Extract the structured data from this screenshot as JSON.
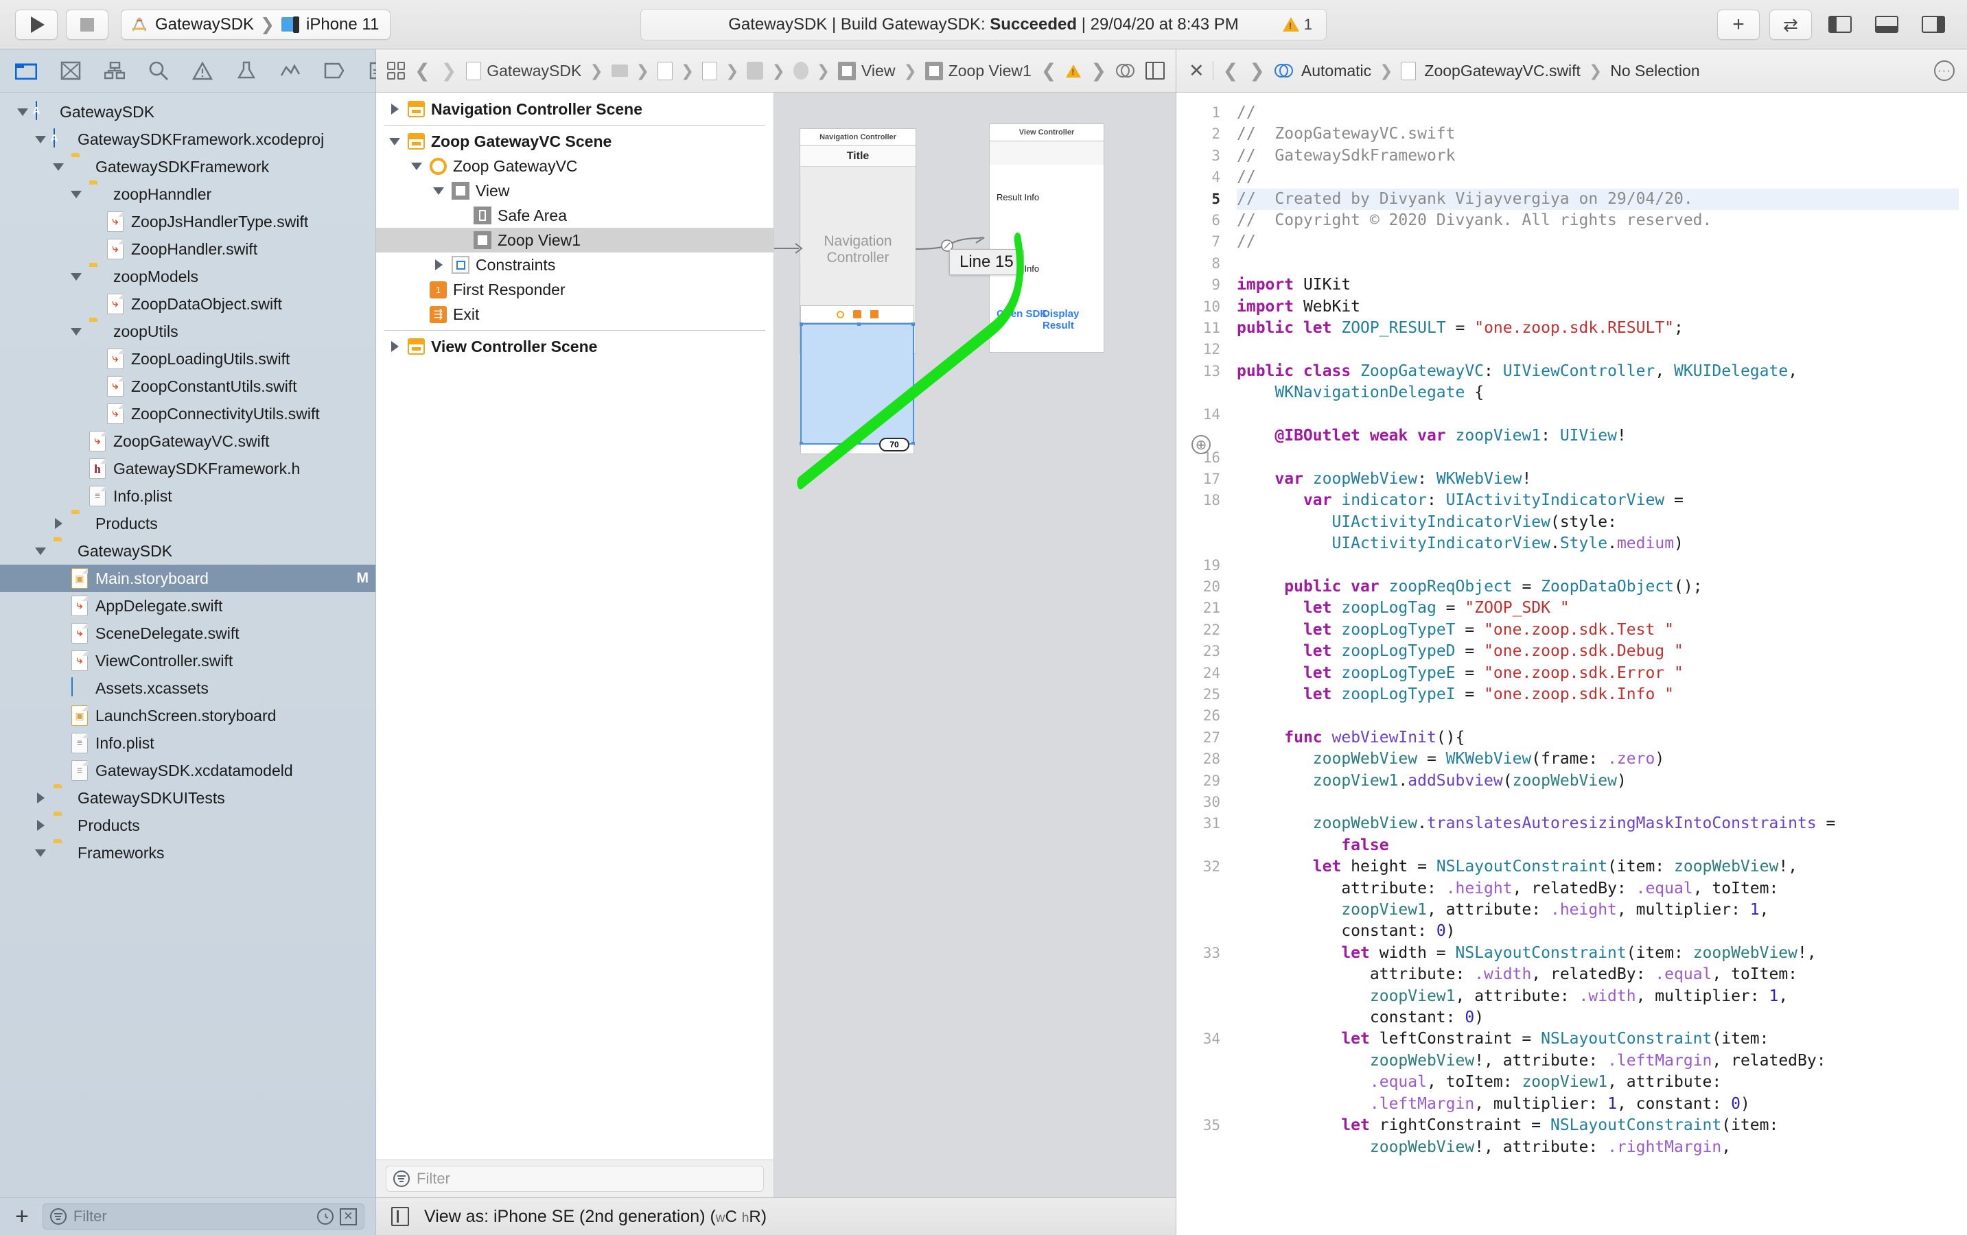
{
  "toolbar": {
    "run_label": "Run",
    "stop_label": "Stop",
    "scheme_name": "GatewaySDK",
    "destination_name": "iPhone 11",
    "status_prefix": "GatewaySDK | Build GatewaySDK: ",
    "status_result": "Succeeded",
    "status_suffix": " | 29/04/20 at 8:43 PM",
    "warning_count": "1",
    "add_label": "+",
    "toggle_label": "⇄"
  },
  "navigator": {
    "tabs": [
      {
        "name": "folder-icon",
        "active": true
      },
      {
        "name": "source-control-icon",
        "active": false
      },
      {
        "name": "symbol-icon",
        "active": false
      },
      {
        "name": "search-icon",
        "active": false
      },
      {
        "name": "warning-icon",
        "active": false
      },
      {
        "name": "test-icon",
        "active": false
      },
      {
        "name": "debug-icon",
        "active": false
      },
      {
        "name": "breakpoint-icon",
        "active": false
      },
      {
        "name": "report-icon",
        "active": false
      }
    ],
    "items": [
      {
        "label": "GatewaySDK",
        "indent": 0,
        "twist": "down",
        "icon": "project",
        "modified": ""
      },
      {
        "label": "GatewaySDKFramework.xcodeproj",
        "indent": 1,
        "twist": "down",
        "icon": "project",
        "modified": ""
      },
      {
        "label": "GatewaySDKFramework",
        "indent": 2,
        "twist": "down",
        "icon": "folder",
        "modified": ""
      },
      {
        "label": "zoopHanndler",
        "indent": 3,
        "twist": "down",
        "icon": "folder",
        "modified": ""
      },
      {
        "label": "ZoopJsHandlerType.swift",
        "indent": 4,
        "twist": "",
        "icon": "swift",
        "modified": ""
      },
      {
        "label": "ZoopHandler.swift",
        "indent": 4,
        "twist": "",
        "icon": "swift",
        "modified": ""
      },
      {
        "label": "zoopModels",
        "indent": 3,
        "twist": "down",
        "icon": "folder",
        "modified": ""
      },
      {
        "label": "ZoopDataObject.swift",
        "indent": 4,
        "twist": "",
        "icon": "swift",
        "modified": ""
      },
      {
        "label": "zoopUtils",
        "indent": 3,
        "twist": "down",
        "icon": "folder",
        "modified": ""
      },
      {
        "label": "ZoopLoadingUtils.swift",
        "indent": 4,
        "twist": "",
        "icon": "swift",
        "modified": ""
      },
      {
        "label": "ZoopConstantUtils.swift",
        "indent": 4,
        "twist": "",
        "icon": "swift",
        "modified": ""
      },
      {
        "label": "ZoopConnectivityUtils.swift",
        "indent": 4,
        "twist": "",
        "icon": "swift",
        "modified": ""
      },
      {
        "label": "ZoopGatewayVC.swift",
        "indent": 3,
        "twist": "",
        "icon": "swift",
        "modified": ""
      },
      {
        "label": "GatewaySDKFramework.h",
        "indent": 3,
        "twist": "",
        "icon": "header",
        "modified": ""
      },
      {
        "label": "Info.plist",
        "indent": 3,
        "twist": "",
        "icon": "plist",
        "modified": ""
      },
      {
        "label": "Products",
        "indent": 2,
        "twist": "right",
        "icon": "folder-closed",
        "modified": ""
      },
      {
        "label": "GatewaySDK",
        "indent": 1,
        "twist": "down",
        "icon": "folder",
        "modified": ""
      },
      {
        "label": "Main.storyboard",
        "indent": 2,
        "twist": "",
        "icon": "storyboard",
        "modified": "M",
        "selected": true
      },
      {
        "label": "AppDelegate.swift",
        "indent": 2,
        "twist": "",
        "icon": "swift",
        "modified": ""
      },
      {
        "label": "SceneDelegate.swift",
        "indent": 2,
        "twist": "",
        "icon": "swift",
        "modified": ""
      },
      {
        "label": "ViewController.swift",
        "indent": 2,
        "twist": "",
        "icon": "swift",
        "modified": ""
      },
      {
        "label": "Assets.xcassets",
        "indent": 2,
        "twist": "",
        "icon": "xcassets",
        "modified": ""
      },
      {
        "label": "LaunchScreen.storyboard",
        "indent": 2,
        "twist": "",
        "icon": "storyboard",
        "modified": ""
      },
      {
        "label": "Info.plist",
        "indent": 2,
        "twist": "",
        "icon": "plist",
        "modified": ""
      },
      {
        "label": "GatewaySDK.xcdatamodeld",
        "indent": 2,
        "twist": "",
        "icon": "plist",
        "modified": ""
      },
      {
        "label": "GatewaySDKUITests",
        "indent": 1,
        "twist": "right",
        "icon": "folder-closed",
        "modified": ""
      },
      {
        "label": "Products",
        "indent": 1,
        "twist": "right",
        "icon": "folder-closed",
        "modified": ""
      },
      {
        "label": "Frameworks",
        "indent": 1,
        "twist": "down",
        "icon": "folder",
        "modified": ""
      }
    ],
    "filter_placeholder": "Filter",
    "add_button_label": "+"
  },
  "storyboard": {
    "jumpbar": {
      "crumbs": [
        {
          "label": "GatewaySDK",
          "icon": "project-icon"
        },
        {
          "label": "",
          "icon": "folder-icon"
        },
        {
          "label": "",
          "icon": "storyboard-icon"
        },
        {
          "label": "",
          "icon": "storyboard-icon"
        },
        {
          "label": "",
          "icon": "scene-icon"
        },
        {
          "label": "",
          "icon": "view-controller-icon"
        },
        {
          "label": "View",
          "icon": "view-icon"
        },
        {
          "label": "Zoop View1",
          "icon": "view-icon"
        }
      ]
    },
    "outline": [
      {
        "label": "Navigation Controller Scene",
        "indent": 0,
        "twist": "right",
        "icon": "scene",
        "bold": true
      },
      {
        "label": "Zoop GatewayVC Scene",
        "indent": 0,
        "twist": "down",
        "icon": "scene",
        "bold": true
      },
      {
        "label": "Zoop GatewayVC",
        "indent": 1,
        "twist": "down",
        "icon": "vc",
        "bold": false
      },
      {
        "label": "View",
        "indent": 2,
        "twist": "down",
        "icon": "view",
        "bold": false
      },
      {
        "label": "Safe Area",
        "indent": 3,
        "twist": "",
        "icon": "safe",
        "bold": false
      },
      {
        "label": "Zoop View1",
        "indent": 3,
        "twist": "",
        "icon": "view",
        "bold": false,
        "selected": true
      },
      {
        "label": "Constraints",
        "indent": 2,
        "twist": "right",
        "icon": "constraints",
        "bold": false
      },
      {
        "label": "First Responder",
        "indent": 1,
        "twist": "",
        "icon": "first-responder",
        "bold": false
      },
      {
        "label": "Exit",
        "indent": 1,
        "twist": "",
        "icon": "exit",
        "bold": false
      },
      {
        "label": "View Controller Scene",
        "indent": 0,
        "twist": "right",
        "icon": "scene",
        "bold": true
      }
    ],
    "filter_placeholder": "Filter",
    "canvas": {
      "nav_scene_title": "Navigation Controller",
      "nav_bar_title": "Title",
      "nav_center_label": "Navigation Controller",
      "vc_scene_title": "View Controller",
      "vc_label_1": "Result Info",
      "vc_label_2": "Result Info",
      "vc_button_1": "Open SDK",
      "vc_button_2": "Display Result",
      "zoom_label": "70",
      "tooltip": "Line 15"
    },
    "statusbar": {
      "view_as_prefix": "View as: iPhone SE (2nd generation) (",
      "view_as_w": "w",
      "view_as_wc": "C",
      "view_as_h": "h",
      "view_as_hr": "R",
      "view_as_suffix": ")"
    }
  },
  "editor": {
    "jumpbar": {
      "close_label": "✕",
      "assistant_label": "Automatic",
      "file_label": "ZoopGatewayVC.swift",
      "selection_label": "No Selection"
    },
    "lines": [
      {
        "n": "1",
        "html": "<span class='cmt'>//</span>"
      },
      {
        "n": "2",
        "html": "<span class='cmt'>//  ZoopGatewayVC.swift</span>"
      },
      {
        "n": "3",
        "html": "<span class='cmt'>//  GatewaySdkFramework</span>"
      },
      {
        "n": "4",
        "html": "<span class='cmt'>//</span>"
      },
      {
        "n": "5",
        "html": "<span class='cmt'>//  Created by Divyank Vijayvergiya on 29/04/20.</span>",
        "hl": true
      },
      {
        "n": "6",
        "html": "<span class='cmt'>//  Copyright © 2020 Divyank. All rights reserved.</span>"
      },
      {
        "n": "7",
        "html": "<span class='cmt'>//</span>"
      },
      {
        "n": "8",
        "html": ""
      },
      {
        "n": "9",
        "html": "<span class='kw'>import</span> UIKit"
      },
      {
        "n": "10",
        "html": "<span class='kw'>import</span> WebKit"
      },
      {
        "n": "11",
        "html": "<span class='kw'>public let</span> <span class='ty'>ZOOP_RESULT</span> = <span class='str'>\"one.zoop.sdk.RESULT\"</span>;"
      },
      {
        "n": "12",
        "html": ""
      },
      {
        "n": "13",
        "html": "<span class='kw'>public class</span> <span class='ty'>ZoopGatewayVC</span>: <span class='ty'>UIViewController</span>, <span class='ty'>WKUIDelegate</span>,\n    <span class='ty'>WKNavigationDelegate</span> {"
      },
      {
        "n": "14",
        "html": ""
      },
      {
        "n": "",
        "bp": true,
        "html": "    <span class='kw'>@IBOutlet weak var</span> <span class='ty'>zoopView1</span>: <span class='ty'>UIView</span>!"
      },
      {
        "n": "16",
        "html": ""
      },
      {
        "n": "17",
        "html": "    <span class='kw'>var</span> <span class='ty'>zoopWebView</span>: <span class='ty'>WKWebView</span>!"
      },
      {
        "n": "18",
        "html": "       <span class='kw'>var</span> <span class='ty'>indicator</span>: <span class='ty'>UIActivityIndicatorView</span> =\n          <span class='ty'>UIActivityIndicatorView</span>(style:\n          <span class='ty'>UIActivityIndicatorView</span>.<span class='ty'>Style</span>.<span class='enumv'>medium</span>)"
      },
      {
        "n": "19",
        "html": ""
      },
      {
        "n": "20",
        "html": "     <span class='kw'>public var</span> <span class='ty'>zoopReqObject</span> = <span class='ty'>ZoopDataObject</span>();"
      },
      {
        "n": "21",
        "html": "       <span class='kw'>let</span> <span class='ty'>zoopLogTag</span> = <span class='str'>\"ZOOP_SDK \"</span>"
      },
      {
        "n": "22",
        "html": "       <span class='kw'>let</span> <span class='ty'>zoopLogTypeT</span> = <span class='str'>\"one.zoop.sdk.Test \"</span>"
      },
      {
        "n": "23",
        "html": "       <span class='kw'>let</span> <span class='ty'>zoopLogTypeD</span> = <span class='str'>\"one.zoop.sdk.Debug \"</span>"
      },
      {
        "n": "24",
        "html": "       <span class='kw'>let</span> <span class='ty'>zoopLogTypeE</span> = <span class='str'>\"one.zoop.sdk.Error \"</span>"
      },
      {
        "n": "25",
        "html": "       <span class='kw'>let</span> <span class='ty'>zoopLogTypeI</span> = <span class='str'>\"one.zoop.sdk.Info \"</span>"
      },
      {
        "n": "26",
        "html": ""
      },
      {
        "n": "27",
        "html": "     <span class='kw'>func</span> <span class='mth'>webViewInit</span>(){"
      },
      {
        "n": "28",
        "html": "        <span class='prop'>zoopWebView</span> = <span class='ty'>WKWebView</span>(frame: <span class='enumv'>.zero</span>)"
      },
      {
        "n": "29",
        "html": "        <span class='prop'>zoopView1</span>.<span class='mth'>addSubview</span>(<span class='prop'>zoopWebView</span>)"
      },
      {
        "n": "30",
        "html": ""
      },
      {
        "n": "31",
        "html": "        <span class='prop'>zoopWebView</span>.<span class='mth'>translatesAutoresizingMaskIntoConstraints</span> =\n           <span class='kw'>false</span>"
      },
      {
        "n": "32",
        "html": "        <span class='kw'>let</span> height = <span class='ty'>NSLayoutConstraint</span>(item: <span class='prop'>zoopWebView</span>!,\n           attribute: <span class='enumv'>.height</span>, relatedBy: <span class='enumv'>.equal</span>, toItem:\n           <span class='prop'>zoopView1</span>, attribute: <span class='enumv'>.height</span>, multiplier: <span class='num'>1</span>,\n           constant: <span class='num'>0</span>)"
      },
      {
        "n": "33",
        "html": "           <span class='kw'>let</span> width = <span class='ty'>NSLayoutConstraint</span>(item: <span class='prop'>zoopWebView</span>!,\n              attribute: <span class='enumv'>.width</span>, relatedBy: <span class='enumv'>.equal</span>, toItem:\n              <span class='prop'>zoopView1</span>, attribute: <span class='enumv'>.width</span>, multiplier: <span class='num'>1</span>,\n              constant: <span class='num'>0</span>)"
      },
      {
        "n": "34",
        "html": "           <span class='kw'>let</span> leftConstraint = <span class='ty'>NSLayoutConstraint</span>(item:\n              <span class='prop'>zoopWebView</span>!, attribute: <span class='enumv'>.leftMargin</span>, relatedBy:\n              <span class='enumv'>.equal</span>, toItem: <span class='prop'>zoopView1</span>, attribute:\n              <span class='enumv'>.leftMargin</span>, multiplier: <span class='num'>1</span>, constant: <span class='num'>0</span>)"
      },
      {
        "n": "35",
        "html": "           <span class='kw'>let</span> rightConstraint = <span class='ty'>NSLayoutConstraint</span>(item:\n              <span class='prop'>zoopWebView</span>!, attribute: <span class='enumv'>.rightMargin</span>,"
      }
    ]
  },
  "colors": {
    "accent_blue": "#0a66d6",
    "selection_blue": "#7f95ae",
    "annotation_green": "#19e019",
    "warning_yellow": "#f0ad18",
    "string_red": "#c62f2f",
    "keyword_purple": "#a119a1"
  }
}
